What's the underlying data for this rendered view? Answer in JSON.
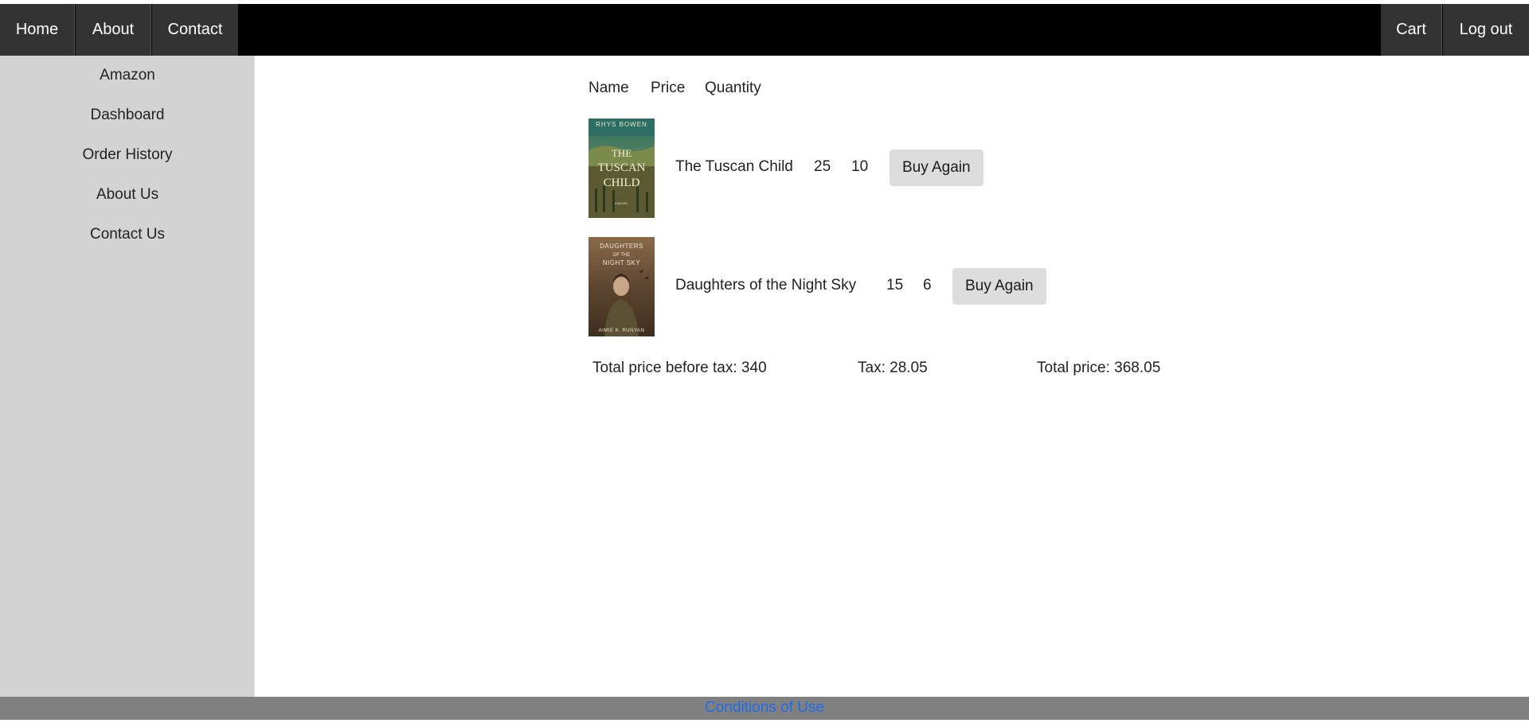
{
  "navbar": {
    "left": [
      "Home",
      "About",
      "Contact"
    ],
    "right": [
      "Cart",
      "Log out"
    ]
  },
  "sidebar": {
    "items": [
      "Amazon",
      "Dashboard",
      "Order History",
      "About Us",
      "Contact Us"
    ]
  },
  "table": {
    "headers": [
      "Name",
      "Price",
      "Quantity"
    ],
    "rows": [
      {
        "name": "The Tuscan Child",
        "price": "25",
        "quantity": "10",
        "button": "Buy Again",
        "cover": {
          "author": "RHYS BOWEN",
          "title_lines": [
            "THE",
            "TUSCAN",
            "CHILD"
          ],
          "subtitle": "A NOVEL"
        }
      },
      {
        "name": "Daughters of the Night Sky",
        "price": "15",
        "quantity": "6",
        "button": "Buy Again",
        "cover": {
          "title_lines": [
            "DAUGHTERS",
            "OF THE",
            "NIGHT SKY"
          ],
          "author": "AIMIE K. RUNYAN"
        }
      }
    ]
  },
  "totals": {
    "before_tax": "Total price before tax: 340",
    "tax": "Tax: 28.05",
    "total": "Total price: 368.05"
  },
  "footer": {
    "link": "Conditions of Use",
    "link_color": "#1e6cf0"
  }
}
